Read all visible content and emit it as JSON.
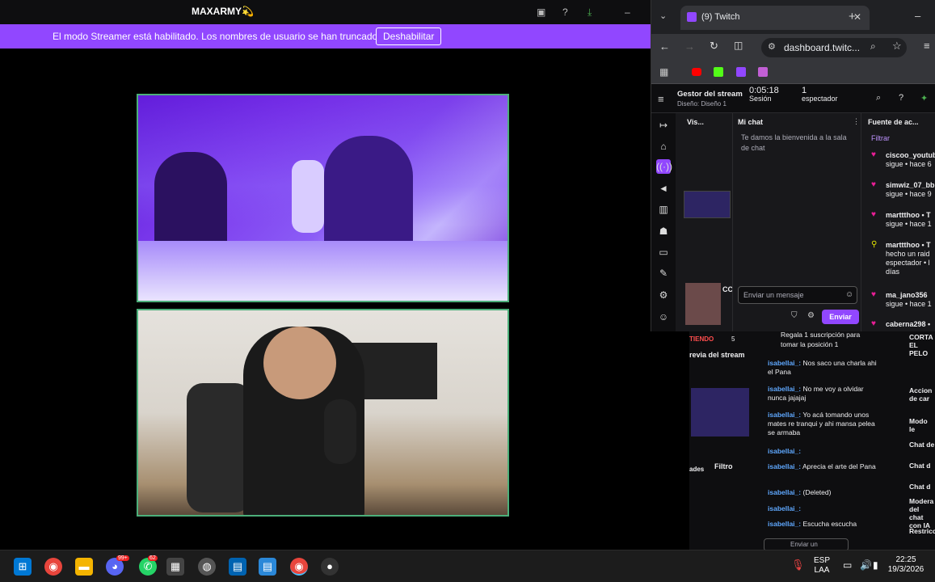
{
  "top": {
    "window_title": "MAXARMY💫",
    "banner_message": "El modo Streamer está habilitado. Los nombres de usuario se han truncado.",
    "banner_button": "Deshabilitar"
  },
  "browser": {
    "tab_title": "(9) Twitch",
    "url": "dashboard.twitc...",
    "new_tab": "+",
    "close_tab": "✕"
  },
  "dashboard": {
    "manager_title": "Gestor del stream",
    "layout": "Diseño: Diseño 1",
    "session_time": "0:05:18",
    "session_label": "Sesión",
    "viewers_count": "1",
    "viewers_label": "espectador",
    "col_preview": "Vis...",
    "col_chat": "Mi chat",
    "col_activity": "Fuente de ac...",
    "filter": "Filtrar",
    "welcome": "Te damos la bienvenida a la sala de chat",
    "chat_placeholder": "Enviar un mensaje",
    "send_button": "Enviar",
    "cc_label": "CC",
    "activity": [
      {
        "user": "ciscoo_youtub",
        "text": "sigue • hace 6"
      },
      {
        "user": "simwiz_07_bb",
        "text": "sigue • hace 9"
      },
      {
        "user": "marttthoo • T",
        "text": "sigue • hace 1"
      },
      {
        "user": "marttthoo • T",
        "text": "hecho un raid espectador • l días"
      },
      {
        "user": "ma_jano356",
        "text": "sigue • hace 1"
      },
      {
        "user": "caberna298 •",
        "text": ""
      }
    ]
  },
  "background_dash": {
    "tiendo": "TIENDO",
    "five": "5",
    "gift_text": "Regala 1 suscripción para tomar la posición 1",
    "preview_label": "revia del stream",
    "ades": "ades",
    "filtro": "Filtro",
    "right_top": "CORTA EL PELO",
    "send_small": "Enviar un",
    "messages": [
      {
        "user": "isabellai_:",
        "text": "Nos saco una charla ahi el Pana"
      },
      {
        "user": "isabellai_:",
        "text": "No me voy a olvidar nunca jajajaj"
      },
      {
        "user": "isabellai_:",
        "text": "Yo acá tomando unos mates re tranqui y ahi mansa pelea se armaba"
      },
      {
        "user": "isabellai_:",
        "text": ""
      },
      {
        "user": "isabellai_:",
        "text": "Aprecia el arte del Pana"
      },
      {
        "user": "isabellai_:",
        "text": "(Deleted)"
      },
      {
        "user": "isabellai_:",
        "text": ""
      },
      {
        "user": "isabellai_:",
        "text": "Escucha escucha"
      }
    ],
    "right_items": [
      "Accion de car",
      "Modo le",
      "Chat de",
      "Chat d",
      "Chat d",
      "Modera del chat con IA",
      "Restricc"
    ]
  },
  "taskbar": {
    "chat_badge": "99+",
    "whatsapp_badge": "62",
    "lang": "ESP",
    "lang_sub": "LAA",
    "time": "22:25",
    "date": "19/3/2026"
  }
}
